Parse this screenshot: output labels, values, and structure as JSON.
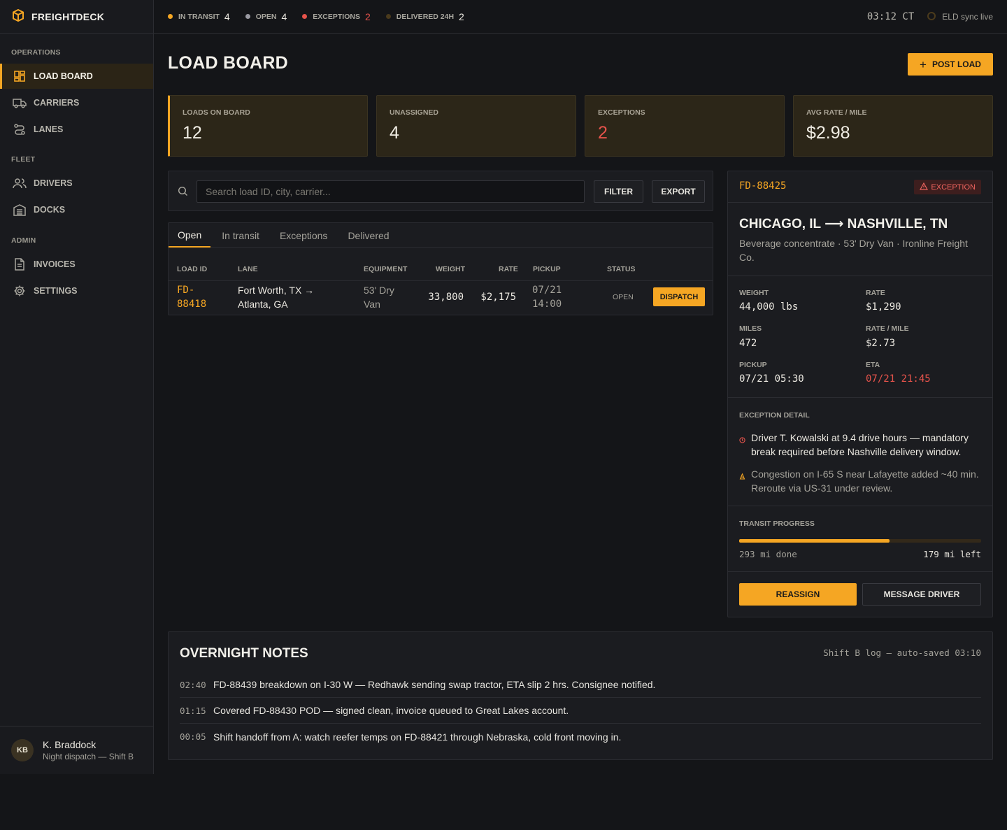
{
  "brand": {
    "name": "FREIGHTDECK"
  },
  "topbar": {
    "stats": [
      {
        "label": "IN TRANSIT",
        "value": "4",
        "color": "#f5a623"
      },
      {
        "label": "OPEN",
        "value": "4",
        "color": "#9a9aa2"
      },
      {
        "label": "EXCEPTIONS",
        "value": "2",
        "color": "#e5534b"
      },
      {
        "label": "DELIVERED 24H",
        "value": "2",
        "color": "#4a3a1c"
      }
    ],
    "clock": "03:12 CT",
    "eld_status": "ELD sync live"
  },
  "sidebar": {
    "sections": [
      {
        "title": "OPERATIONS",
        "items": [
          {
            "label": "LOAD BOARD",
            "icon": "dashboard-icon",
            "active": true
          },
          {
            "label": "CARRIERS",
            "icon": "truck-icon"
          },
          {
            "label": "LANES",
            "icon": "route-icon"
          }
        ]
      },
      {
        "title": "FLEET",
        "items": [
          {
            "label": "DRIVERS",
            "icon": "users-icon"
          },
          {
            "label": "DOCKS",
            "icon": "warehouse-icon"
          }
        ]
      },
      {
        "title": "ADMIN",
        "items": [
          {
            "label": "INVOICES",
            "icon": "document-icon"
          },
          {
            "label": "SETTINGS",
            "icon": "gear-icon"
          }
        ]
      }
    ],
    "user": {
      "initials": "KB",
      "name": "K. Braddock",
      "role": "Night dispatch — Shift B"
    }
  },
  "main": {
    "title": "LOAD BOARD",
    "post_load_label": "POST LOAD",
    "kpis": [
      {
        "label": "LOADS ON BOARD",
        "value": "12"
      },
      {
        "label": "UNASSIGNED",
        "value": "4"
      },
      {
        "label": "EXCEPTIONS",
        "value": "2"
      },
      {
        "label": "AVG RATE / MILE",
        "value": "$2.98"
      }
    ],
    "search": {
      "placeholder": "Search load ID, city, carrier...",
      "filter_label": "FILTER",
      "export_label": "EXPORT"
    },
    "tabs": [
      "Open",
      "In transit",
      "Exceptions",
      "Delivered"
    ],
    "table": {
      "columns": [
        "LOAD ID",
        "LANE",
        "EQUIPMENT",
        "WEIGHT",
        "RATE",
        "PICKUP",
        "STATUS"
      ],
      "rows": [
        {
          "id_line1": "FD-",
          "id_line2": "88418",
          "lane_line1": "Fort Worth, TX →",
          "lane_line2": "Atlanta, GA",
          "equip_line1": "53' Dry",
          "equip_line2": "Van",
          "weight": "33,800",
          "rate": "$2,175",
          "pickup_line1": "07/21",
          "pickup_line2": "14:00",
          "status": "OPEN",
          "action": "DISPATCH"
        }
      ]
    }
  },
  "detail": {
    "load_id": "FD-88425",
    "badge": "EXCEPTION",
    "route": "CHICAGO, IL ⟶ NASHVILLE, TN",
    "subtitle": "Beverage concentrate · 53' Dry Van · Ironline Freight Co.",
    "metrics": {
      "weight_label": "WEIGHT",
      "weight": "44,000 lbs",
      "rate_label": "RATE",
      "rate": "$1,290",
      "miles_label": "MILES",
      "miles": "472",
      "rpm_label": "RATE / MILE",
      "rpm": "$2.73",
      "pickup_label": "PICKUP",
      "pickup": "07/21 05:30",
      "eta_label": "ETA",
      "eta": "07/21 21:45"
    },
    "exception_title": "EXCEPTION DETAIL",
    "exceptions": [
      {
        "icon": "clock-icon",
        "text": "Driver T. Kowalski at 9.4 drive hours — mandatory break required before Nashville delivery window."
      },
      {
        "icon": "traffic-cone-icon",
        "text": "Congestion on I-65 S near Lafayette added ~40 min. Reroute via US-31 under review."
      }
    ],
    "progress_title": "TRANSIT PROGRESS",
    "progress_fraction": 0.62,
    "progress_done": "293 mi done",
    "progress_left": "179 mi left",
    "reassign_label": "REASSIGN",
    "message_label": "MESSAGE DRIVER"
  },
  "notes": {
    "title": "OVERNIGHT NOTES",
    "meta": "Shift B log — auto-saved 03:10",
    "entries": [
      {
        "time": "02:40",
        "text": "FD-88439 breakdown on I-30 W — Redhawk sending swap tractor, ETA slip 2 hrs. Consignee notified."
      },
      {
        "time": "01:15",
        "text": "Covered FD-88430 POD — signed clean, invoice queued to Great Lakes account."
      },
      {
        "time": "00:05",
        "text": "Shift handoff from A: watch reefer temps on FD-88421 through Nebraska, cold front moving in."
      }
    ]
  },
  "colors": {
    "accent": "#f5a623",
    "danger": "#e5534b"
  }
}
